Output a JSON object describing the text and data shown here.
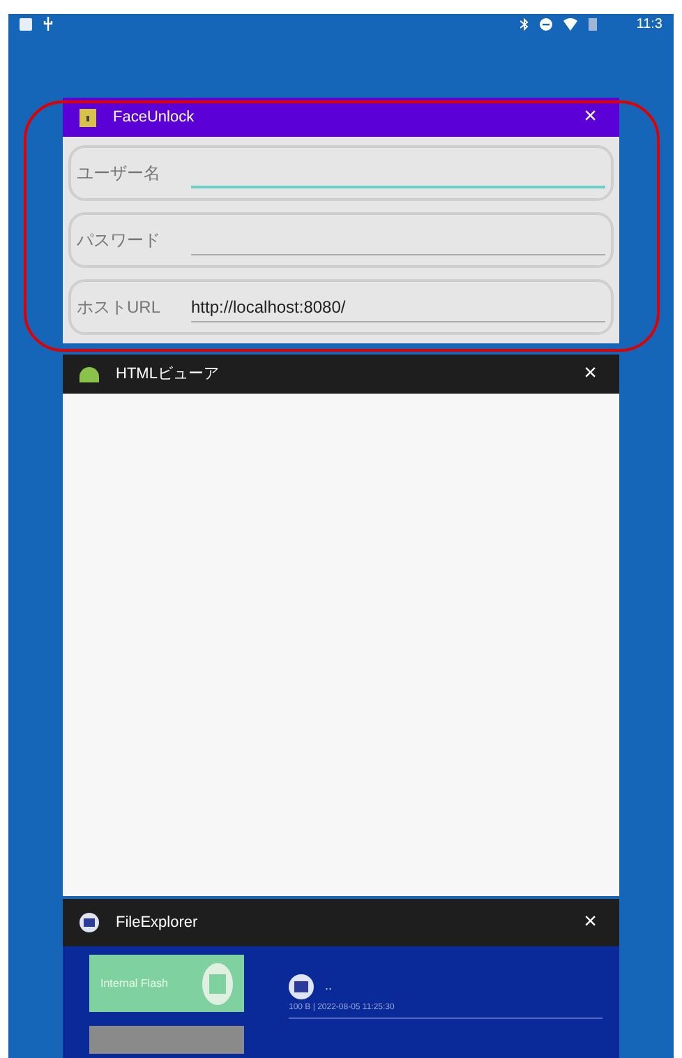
{
  "status_bar": {
    "time": "11:3"
  },
  "face_unlock": {
    "title": "FaceUnlock",
    "close": "×",
    "fields": [
      {
        "label": "ユーザー名",
        "focused": true
      },
      {
        "label": "パスワード",
        "focused": false
      },
      {
        "label": "ホストURL",
        "value": "http://localhost:8080/",
        "focused": false
      }
    ]
  },
  "html_viewer": {
    "title": "HTMLビューア",
    "close": "×"
  },
  "file_explorer": {
    "title": "FileExplorer",
    "close": "×",
    "storage": "Internal Flash",
    "entry": {
      "name": "..",
      "meta": "100 B | 2022-08-05 11:25:30"
    }
  }
}
